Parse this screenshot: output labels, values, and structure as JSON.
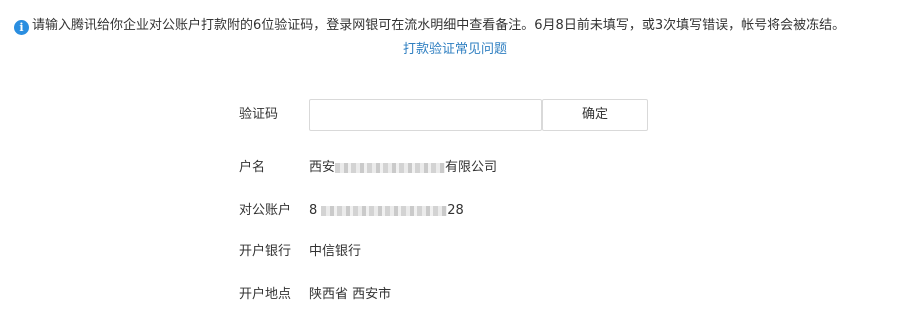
{
  "notice": {
    "icon": "info-icon",
    "text": "请输入腾讯给你企业对公账户打款附的6位验证码，登录网银可在流水明细中查看备注。6月8日前未填写，或3次填写错误，帐号将会被冻结。",
    "color": "#2a8ee0"
  },
  "faq_link": "打款验证常见问题",
  "form": {
    "code_label": "验证码",
    "code_value": "",
    "code_placeholder": "",
    "confirm_label": "确定",
    "account_name_label": "户名",
    "account_name_prefix": "西安",
    "account_name_suffix": "有限公司",
    "account_number_label": "对公账户",
    "account_number_prefix": "8",
    "account_number_suffix": "28",
    "bank_label": "开户银行",
    "bank_value": "中信银行",
    "location_label": "开户地点",
    "location_value": "陕西省 西安市"
  },
  "colors": {
    "link": "#2f7fc1",
    "text": "#333333",
    "border": "#d9d9d9"
  }
}
